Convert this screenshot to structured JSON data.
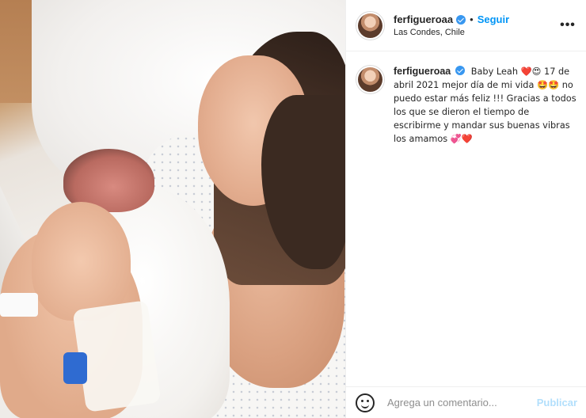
{
  "post": {
    "image_alt": "Mujer en cama de hospital sosteniendo a su bebé recién nacido"
  },
  "header": {
    "username": "ferfigueroaa",
    "separator": "•",
    "follow_label": "Seguir",
    "location": "Las Condes, Chile",
    "more_label": "•••"
  },
  "caption": {
    "username": "ferfigueroaa",
    "text": "Baby Leah ❤️😍 17 de abril 2021 mejor día de mi vida 🤩🤩 no puedo estar más feliz !!! Gracias a todos los que se dieron el tiempo de escribirme y mandar sus buenas vibras los amamos 💞❤️"
  },
  "composer": {
    "placeholder": "Agrega un comentario...",
    "publish_label": "Publicar"
  },
  "colors": {
    "accent": "#0095f6",
    "verified": "#3897f0",
    "publish_disabled": "#b2dffc",
    "border": "#efefef"
  },
  "icons": {
    "verified": "verified-badge-icon",
    "more": "more-options-icon",
    "emoji": "emoji-smile-icon"
  }
}
